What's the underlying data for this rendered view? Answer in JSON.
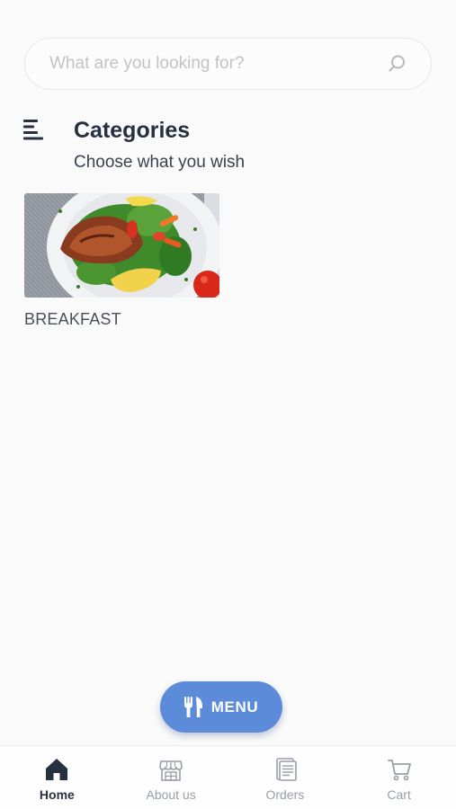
{
  "search": {
    "placeholder": "What are you looking for?"
  },
  "categories_section": {
    "title": "Categories",
    "subtitle": "Choose what you wish"
  },
  "categories": [
    {
      "label": "BREAKFAST",
      "image": "breakfast-plate"
    }
  ],
  "fab": {
    "label": "MENU",
    "icon": "fork-knife-icon"
  },
  "bottom_nav": {
    "active": "Home",
    "items": [
      {
        "label": "Home",
        "icon": "home-icon"
      },
      {
        "label": "About us",
        "icon": "store-icon"
      },
      {
        "label": "Orders",
        "icon": "orders-icon"
      },
      {
        "label": "Cart",
        "icon": "cart-icon"
      }
    ]
  },
  "colors": {
    "accent": "#5b8bd9",
    "text_dark": "#263040",
    "nav_inactive": "#9a9ea6",
    "background": "#fafafa"
  }
}
